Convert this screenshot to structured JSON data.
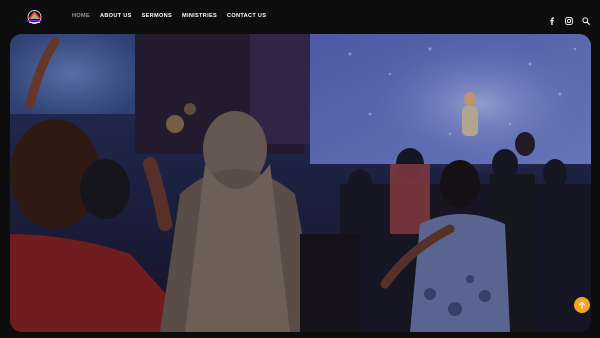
{
  "nav": {
    "items": [
      {
        "label": "HOME",
        "active": true
      },
      {
        "label": "ABOUT US",
        "active": false
      },
      {
        "label": "SERMONS",
        "active": false
      },
      {
        "label": "MINISTRIES",
        "active": false
      },
      {
        "label": "CONTACT US",
        "active": false
      }
    ]
  },
  "social": {
    "icons": [
      "facebook-icon",
      "instagram-icon",
      "search-icon"
    ]
  },
  "colors": {
    "background": "#0d0d0d",
    "accent": "#f5a41f",
    "nav_active": "#9a9a9a"
  },
  "hero": {
    "image_description": "worship concert crowd with raised hands"
  },
  "scroll_top": {
    "icon": "arrow-up-icon"
  }
}
